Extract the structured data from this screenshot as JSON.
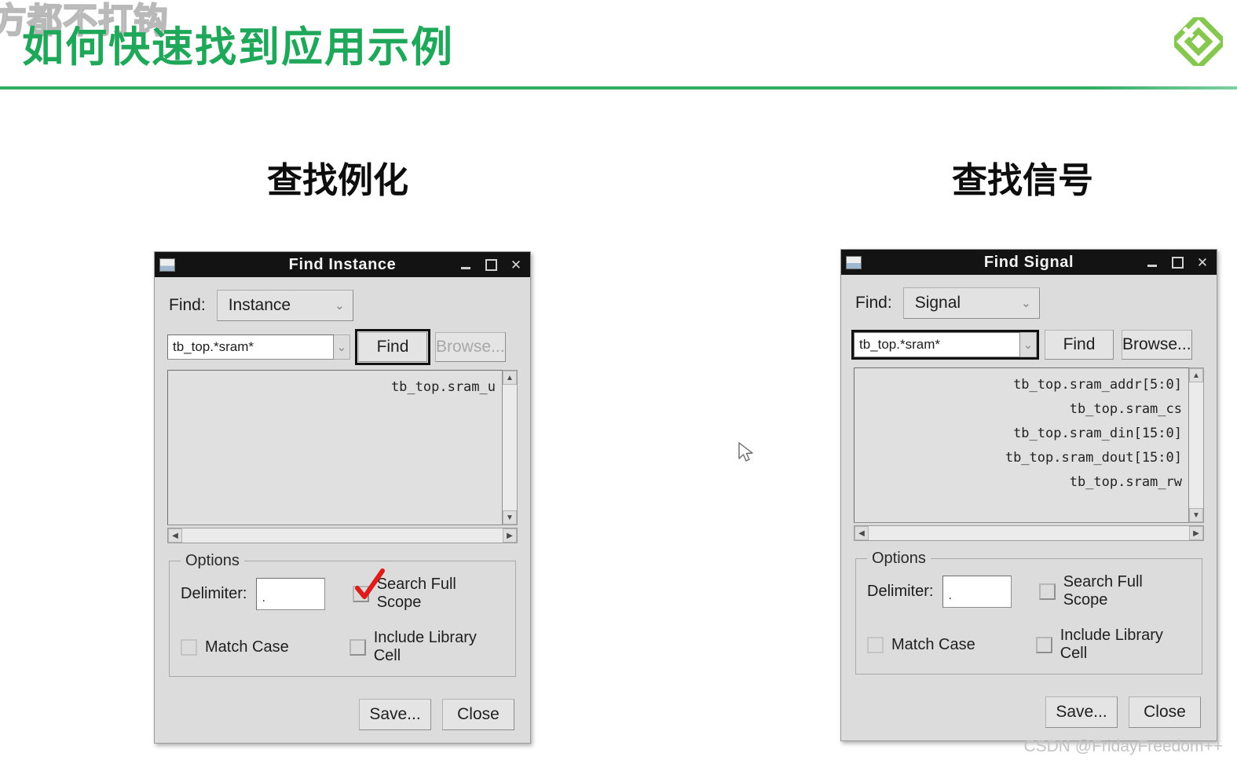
{
  "slide": {
    "title": "如何快速找到应用示例",
    "ghost_title": "方都不打钩",
    "accent_color": "#1fa85a",
    "rule_color": "#2fae60",
    "logo_name": "brand-diamond-logo"
  },
  "headings": {
    "left": "查找例化",
    "right": "查找信号"
  },
  "find_instance": {
    "titlebar": {
      "title": "Find Instance",
      "minimize": "_",
      "maximize": "□",
      "close": "✕"
    },
    "find_label": "Find:",
    "type_combo": {
      "value": "Instance",
      "arrow": "⌄"
    },
    "query": {
      "value": "tb_top.*sram*",
      "placeholder": "tb_top.*sram*",
      "drop_arrow": "⌄",
      "focused": false
    },
    "buttons": {
      "find": "Find",
      "browse": "Browse...",
      "find_focused": true,
      "browse_disabled": true
    },
    "results": [
      "tb_top.sram_u"
    ],
    "options": {
      "legend": "Options",
      "delimiter_label": "Delimiter:",
      "delimiter_value": ".",
      "search_full_scope": "Search Full Scope",
      "match_case": "Match Case",
      "include_library_cell": "Include Library Cell",
      "search_full_scope_checked": false,
      "match_case_checked": false,
      "include_library_cell_checked": false,
      "annotation": "red-check-mark"
    },
    "footer": {
      "save": "Save...",
      "close": "Close"
    }
  },
  "find_signal": {
    "titlebar": {
      "title": "Find Signal",
      "minimize": "_",
      "maximize": "□",
      "close": "✕"
    },
    "find_label": "Find:",
    "type_combo": {
      "value": "Signal",
      "arrow": "⌄"
    },
    "query": {
      "value": "tb_top.*sram*",
      "placeholder": "tb_top.*sram*",
      "drop_arrow": "⌄",
      "focused": true
    },
    "buttons": {
      "find": "Find",
      "browse": "Browse...",
      "find_focused": false,
      "browse_disabled": false
    },
    "results": [
      "tb_top.sram_addr[5:0]",
      "tb_top.sram_cs",
      "tb_top.sram_din[15:0]",
      "tb_top.sram_dout[15:0]",
      "tb_top.sram_rw"
    ],
    "options": {
      "legend": "Options",
      "delimiter_label": "Delimiter:",
      "delimiter_value": ".",
      "search_full_scope": "Search Full Scope",
      "match_case": "Match Case",
      "include_library_cell": "Include Library Cell",
      "search_full_scope_checked": false,
      "match_case_checked": false,
      "include_library_cell_checked": false
    },
    "footer": {
      "save": "Save...",
      "close": "Close"
    }
  },
  "scrollbars": {
    "up_arrow": "▲",
    "down_arrow": "▼",
    "left_arrow": "◀",
    "right_arrow": "▶"
  },
  "watermark": "CSDN @FridayFreedom++"
}
